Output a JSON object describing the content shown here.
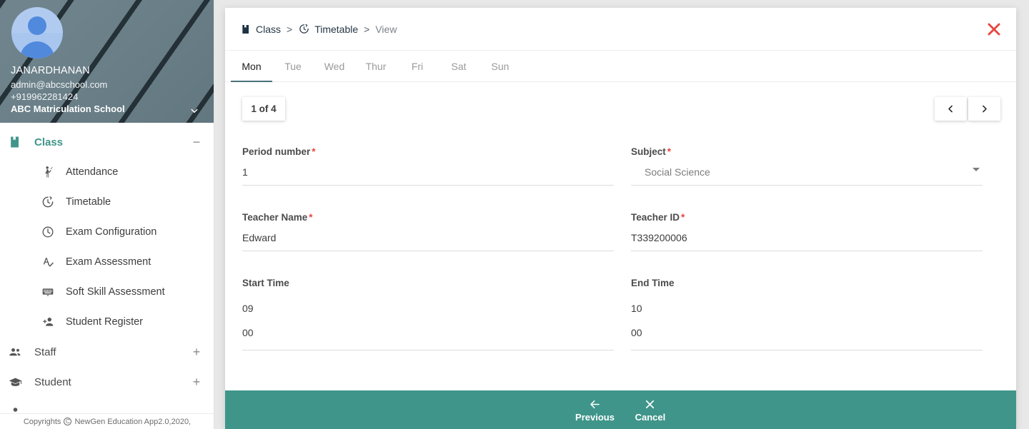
{
  "profile": {
    "name": "JANARDHANAN",
    "email": "admin@abcschool.com",
    "phone": "+919962281424",
    "school": "ABC Matriculation School",
    "expand_icon": "chevron-down-icon",
    "avatar_icon": "user-avatar-icon"
  },
  "sidebar": {
    "groups": [
      {
        "label": "Class",
        "icon": "book-icon",
        "toggle": "−",
        "active": true,
        "items": [
          {
            "label": "Attendance",
            "icon": "person-raising-hand-icon"
          },
          {
            "label": "Timetable",
            "icon": "timer-icon"
          },
          {
            "label": "Exam Configuration",
            "icon": "clock-icon"
          },
          {
            "label": "Exam Assessment",
            "icon": "spellcheck-icon"
          },
          {
            "label": "Soft Skill Assessment",
            "icon": "keyboard-icon"
          },
          {
            "label": "Student Register",
            "icon": "person-add-icon"
          }
        ]
      },
      {
        "label": "Staff",
        "icon": "people-icon",
        "toggle": "+",
        "active": false,
        "items": []
      },
      {
        "label": "Student",
        "icon": "graduation-cap-icon",
        "toggle": "+",
        "active": false,
        "items": []
      }
    ],
    "copyright": {
      "prefix": "Copyrights",
      "mark": "C",
      "suffix": "NewGen Education App2.0,2020,"
    }
  },
  "modal": {
    "breadcrumb": {
      "root_label": "Class",
      "root_icon": "book-icon",
      "sep1": ">",
      "section_label": "Timetable",
      "section_icon": "timer-icon",
      "sep2": ">",
      "current_label": "View"
    },
    "close_icon": "close-icon",
    "tabs": [
      {
        "label": "Mon",
        "active": true
      },
      {
        "label": "Tue",
        "active": false
      },
      {
        "label": "Wed",
        "active": false
      },
      {
        "label": "Thur",
        "active": false
      },
      {
        "label": "Fri",
        "active": false
      },
      {
        "label": "Sat",
        "active": false
      },
      {
        "label": "Sun",
        "active": false
      }
    ],
    "counter": "1 of 4",
    "pager": {
      "prev_icon": "chevron-left-icon",
      "next_icon": "chevron-right-icon"
    },
    "fields": {
      "period_number": {
        "label": "Period number",
        "required": true,
        "value": "1"
      },
      "subject": {
        "label": "Subject",
        "required": true,
        "value": "Social Science",
        "caret_icon": "dropdown-caret-icon"
      },
      "teacher_name": {
        "label": "Teacher Name",
        "required": true,
        "value": "Edward"
      },
      "teacher_id": {
        "label": "Teacher ID",
        "required": true,
        "value": "T339200006"
      },
      "start_time": {
        "label": "Start Time",
        "required": false,
        "hour": "09",
        "minute": "00"
      },
      "end_time": {
        "label": "End Time",
        "required": false,
        "hour": "10",
        "minute": "00"
      }
    },
    "footer": {
      "previous": {
        "label": "Previous",
        "icon": "arrow-left-icon"
      },
      "cancel": {
        "label": "Cancel",
        "icon": "close-icon"
      }
    }
  },
  "colors": {
    "teal": "#3f958a",
    "header_slate": "#6a7f88",
    "required_red": "#e8453c",
    "close_red": "#e8453c",
    "tab_underline": "#4a707a"
  }
}
